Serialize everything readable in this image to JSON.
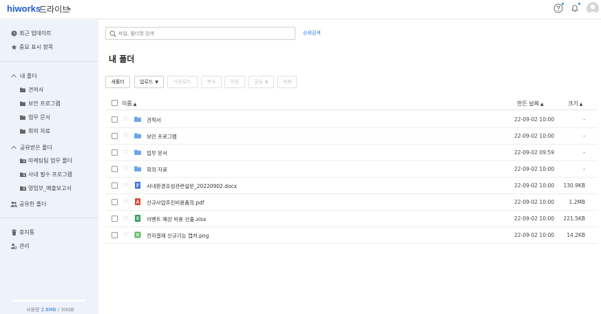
{
  "header": {
    "logo": "hiworks",
    "app_title": "드라이브",
    "caret": "▾",
    "icons": [
      "help-icon",
      "bell-icon",
      "avatar"
    ]
  },
  "sidebar": {
    "quick": [
      {
        "label": "최근 업데이트",
        "icon": "clock-icon"
      },
      {
        "label": "중요 표시 항목",
        "icon": "star-icon"
      }
    ],
    "my_folder": {
      "label": "내 폴더",
      "items": [
        "견적서",
        "보안 프로그램",
        "업무 문서",
        "회의 자료"
      ]
    },
    "shared_received": {
      "label": "공유받은 폴더",
      "items": [
        "마케팅팀 업무 폴더",
        "사내 필수 프로그램",
        "영업부_매출보고서"
      ]
    },
    "shared_folder_label": "공유한 폴더",
    "trash_label": "휴지통",
    "admin_label": "관리",
    "usage": {
      "label": "사용량",
      "used": "2.6MB",
      "total": "/ 30GB",
      "fraction": 0.0001
    }
  },
  "search": {
    "placeholder": "파일, 폴더명 검색",
    "value": "",
    "advanced_label": "상세검색"
  },
  "page_title": "내 폴더",
  "toolbar": {
    "new_folder": "새폴더",
    "upload": "업로드",
    "download": "다운로드",
    "copy": "복사",
    "move": "이동",
    "share": "공유",
    "delete": "삭제"
  },
  "list": {
    "columns": {
      "name": "이름",
      "modified": "만든 날짜",
      "size": "크기",
      "sort_caret": "▲"
    },
    "rows": [
      {
        "name": "견적서",
        "type": "folder",
        "date": "22-09-02 10:00",
        "size": "-"
      },
      {
        "name": "보안 프로그램",
        "type": "folder",
        "date": "22-09-02 10:00",
        "size": "-"
      },
      {
        "name": "업무 문서",
        "type": "folder",
        "date": "22-09-02 09:59",
        "size": "-"
      },
      {
        "name": "회의 자료",
        "type": "folder",
        "date": "22-09-02 10:00",
        "size": "-"
      },
      {
        "name": "사내환경조성관련설문_20220902.docx",
        "type": "docx",
        "date": "22-09-02 10:00",
        "size": "130.9KB"
      },
      {
        "name": "신규사업추진비용품의.pdf",
        "type": "pdf",
        "date": "22-09-02 10:00",
        "size": "1.2MB"
      },
      {
        "name": "이벤트 예상 비용 산출.xlsx",
        "type": "xlsx",
        "date": "22-09-02 10:00",
        "size": "221.5KB"
      },
      {
        "name": "전자결재 신규기능 캡처.png",
        "type": "png",
        "date": "22-09-02 10:00",
        "size": "14.2KB"
      }
    ]
  },
  "colors": {
    "accent": "#2a7be4",
    "sidebar_bg": "#eef2fb",
    "folder": "#6ca8e6",
    "docx": "#3d6fd8",
    "pdf": "#d9442f",
    "xlsx": "#2e9d55",
    "png": "#5cb85c"
  }
}
